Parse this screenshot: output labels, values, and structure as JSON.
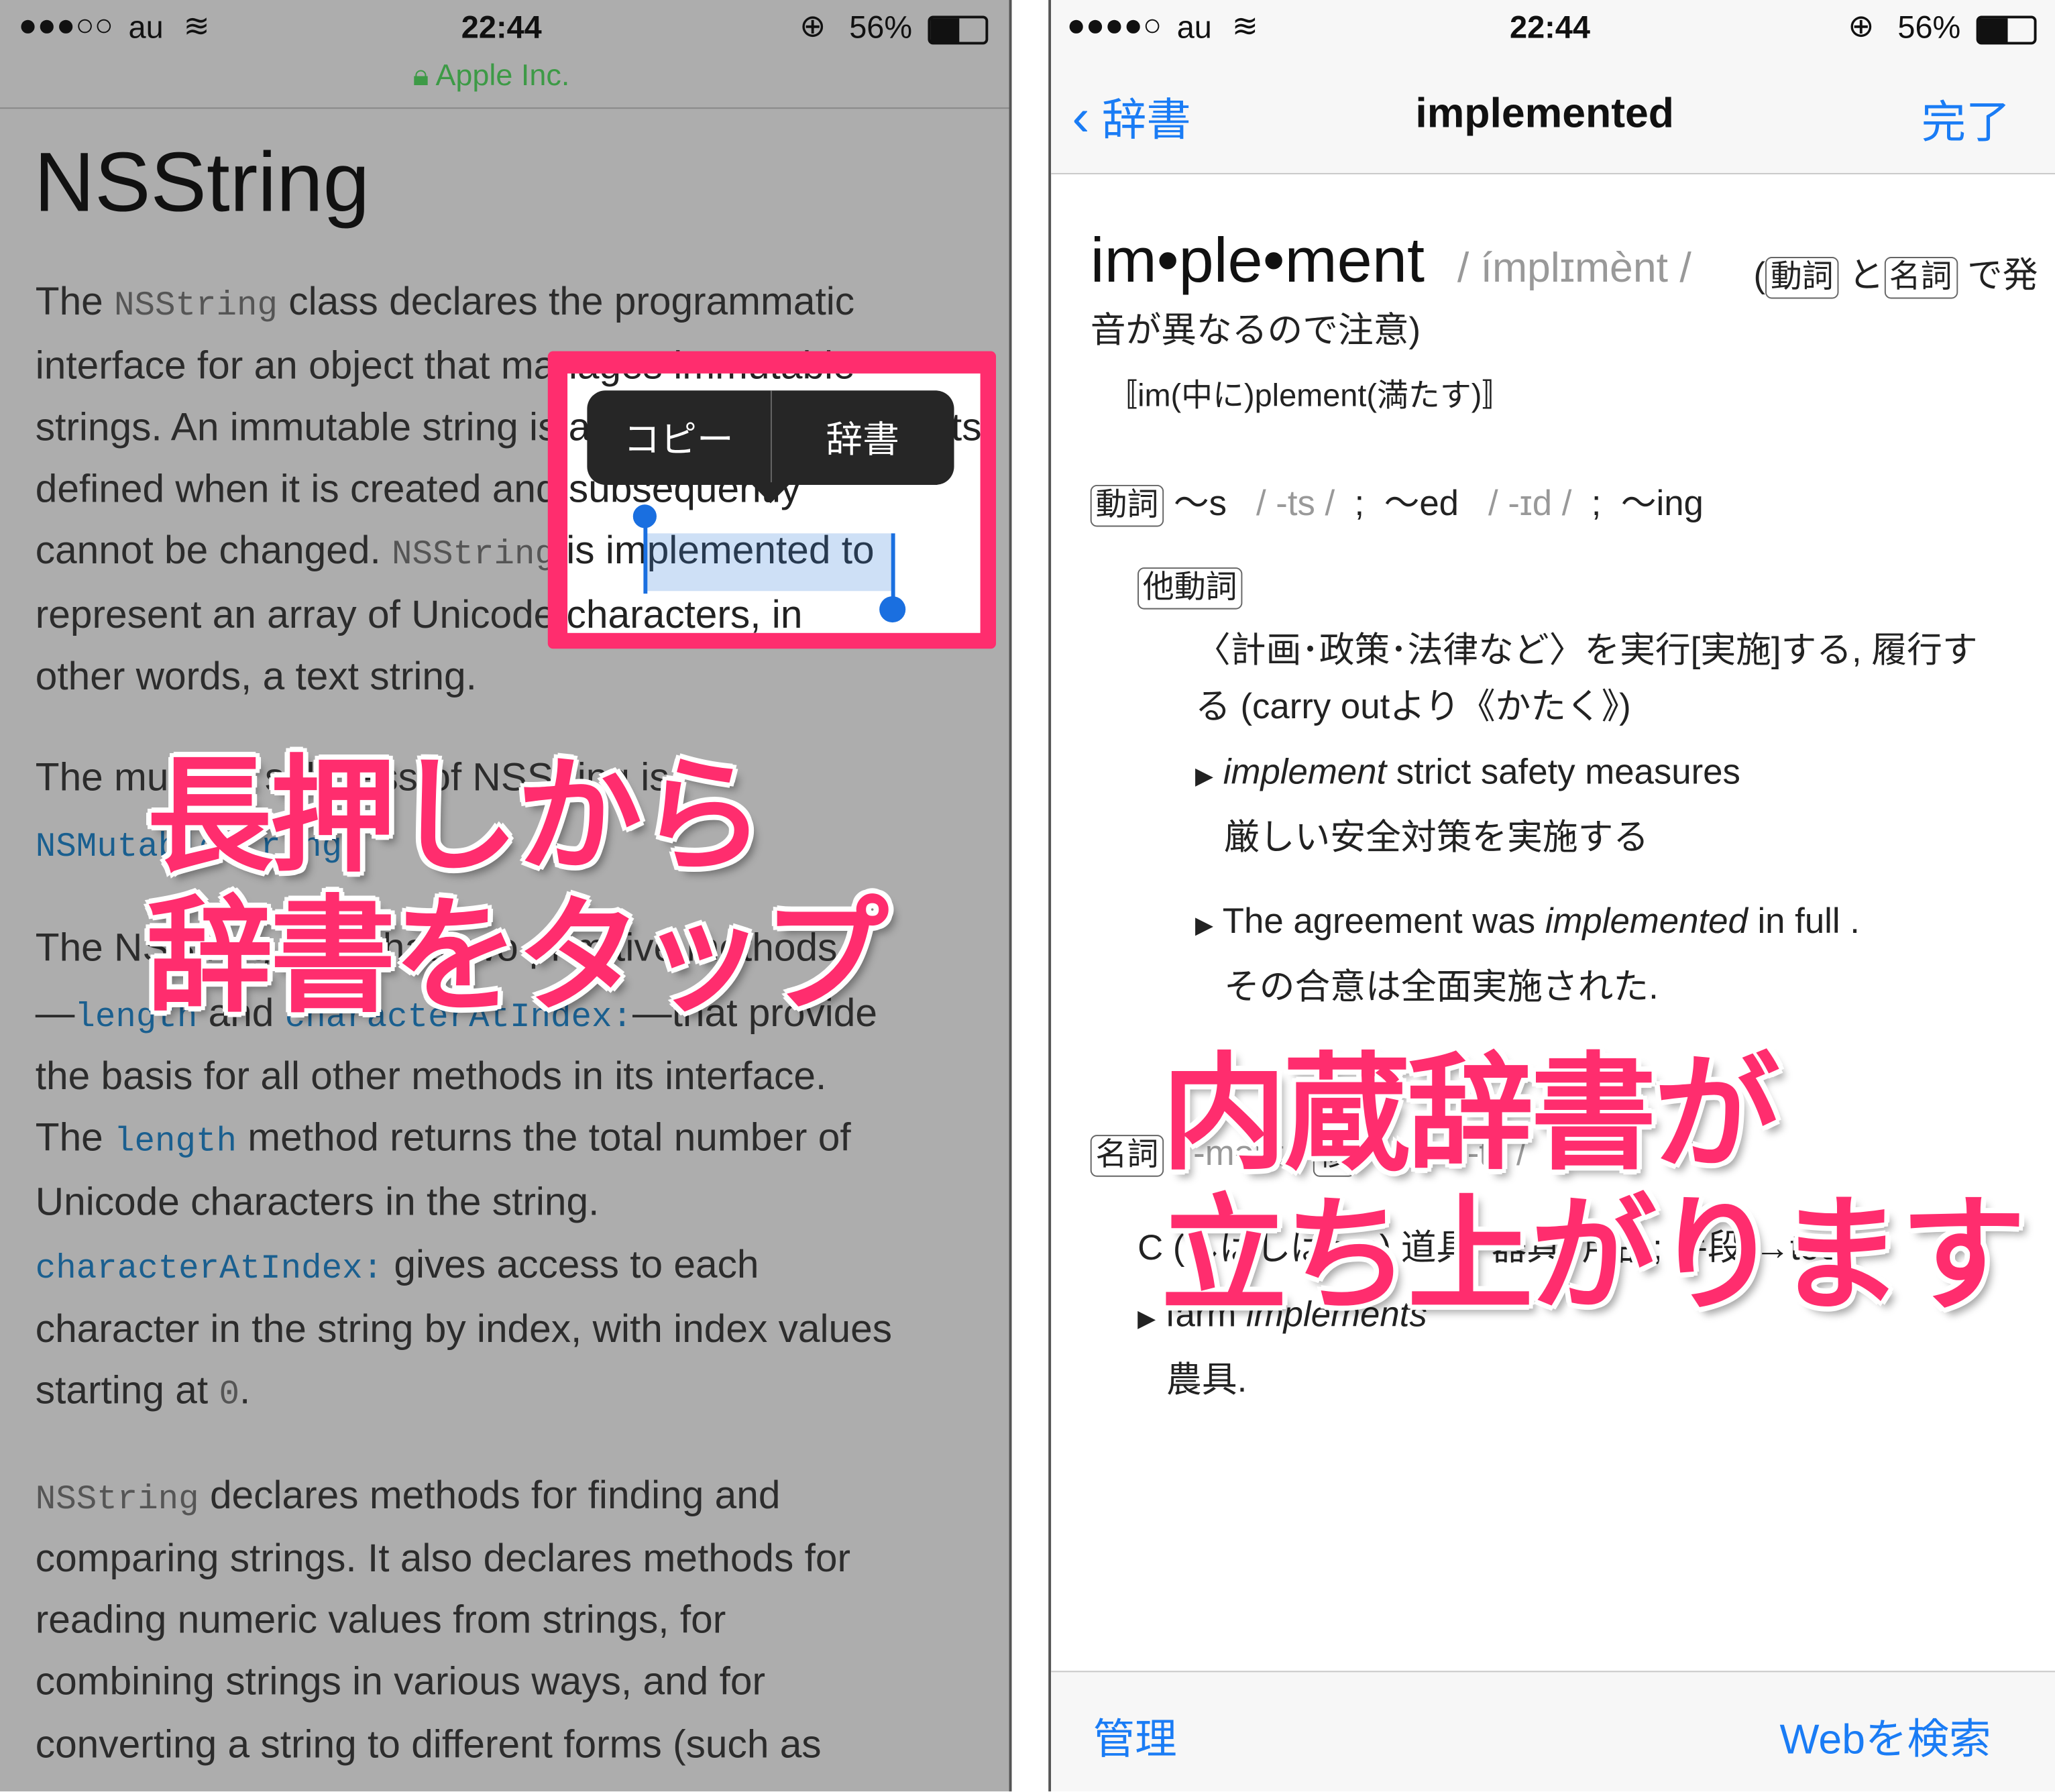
{
  "left": {
    "status": {
      "signal": "●●●○○",
      "carrier": "au",
      "time": "22:44",
      "battery": "56%"
    },
    "site": "Apple Inc.",
    "title": "NSString",
    "lines": [
      [
        {
          "t": "The "
        },
        {
          "t": "NSString",
          "c": "code"
        },
        {
          "t": " class declares the programmatic"
        }
      ],
      [
        {
          "t": "interface for an object that manages immutable"
        }
      ],
      [
        {
          "t": "strings. An immutable string is a string whose contents"
        }
      ],
      [
        {
          "t": "defined when it is created and subsequently"
        }
      ],
      [
        {
          "t": "cannot be changed. "
        },
        {
          "t": "NSString",
          "c": "code"
        },
        {
          "t": " is implemented to"
        }
      ],
      [
        {
          "t": "represent an array of Unicode characters, in"
        }
      ],
      [
        {
          "t": "other words, a text string."
        }
      ],
      [
        {
          "t": "The mutable subclass of NSString is"
        }
      ],
      [
        {
          "t": "NSMutableString",
          "c": "code link"
        }
      ],
      [
        {
          "t": "The NSString class has two primitive methods"
        }
      ],
      [
        {
          "t": "—"
        },
        {
          "t": "length",
          "c": "code link"
        },
        {
          "t": " and "
        },
        {
          "t": "characterAtIndex:",
          "c": "code link"
        },
        {
          "t": "—that provide"
        }
      ],
      [
        {
          "t": "the basis for all other methods in its interface."
        }
      ],
      [
        {
          "t": "The "
        },
        {
          "t": "length",
          "c": "code link"
        },
        {
          "t": " method returns the total number of"
        }
      ],
      [
        {
          "t": "Unicode characters in the string."
        }
      ],
      [
        {
          "t": "characterAtIndex:",
          "c": "code link"
        },
        {
          "t": " gives access to each"
        }
      ],
      [
        {
          "t": "character in the string by index, with index values"
        }
      ],
      [
        {
          "t": "starting at "
        },
        {
          "t": "0",
          "c": "code"
        },
        {
          "t": "."
        }
      ],
      [
        {
          "t": "NSString",
          "c": "code"
        },
        {
          "t": " declares methods for finding and"
        }
      ],
      [
        {
          "t": "comparing strings. It also declares methods for"
        }
      ],
      [
        {
          "t": "reading numeric values from strings, for"
        }
      ],
      [
        {
          "t": "combining strings in various ways, and for"
        }
      ],
      [
        {
          "t": "converting a string to different forms (such as"
        }
      ]
    ],
    "selected_word": "implemented",
    "menu": {
      "copy": "コピー",
      "define": "辞書"
    },
    "caption": [
      "長押しから",
      "辞書をタップ"
    ]
  },
  "right": {
    "status": {
      "signal": "●●●●○",
      "carrier": "au",
      "time": "22:44",
      "battery": "56%"
    },
    "nav": {
      "back": "辞書",
      "title": "implemented",
      "done": "完了"
    },
    "headword": "im•ple•ment",
    "pron": "/ ímplɪmènt /",
    "note_open": "(",
    "tag_verb": "動詞",
    "note_to": "と",
    "tag_noun": "名詞",
    "note_rest1": "で発",
    "note_rest2": "音が異なるので注意)",
    "etym": "〚im(中に)plement(満たす)〛",
    "forms": {
      "s": "〜s",
      "s_pron": "/ -ts /",
      "sep": ";",
      "ed": "〜ed",
      "ed_pron": "/ -ɪd /",
      "ing": "〜ing"
    },
    "tag_transitive": "他動詞",
    "def1a": "〈計画･政策･法律など〉を実行[実施]する, 履行す",
    "def1b": "る (carry outより《かたく》)",
    "ex1_en_i": "implement",
    "ex1_en": " strict safety measures",
    "ex1_ja": "厳しい安全対策を実施する",
    "ex2_en_a": "The agreement was ",
    "ex2_en_i": "implemented",
    "ex2_en_b": " in full .",
    "ex2_ja": "その合意は全面実施された.",
    "noun": {
      "tag": "名詞",
      "pron": "/ -mənt /",
      "plural_tag": "複",
      "s": "〜s",
      "s_pron": "/ -ts /"
    },
    "noun_def": "C (しばしば〜s) 道具, 器具, 用品; 手段(→tool)",
    "ex3_en": "farm ",
    "ex3_en_i": "implements",
    "ex3_ja": "農具.",
    "toolbar": {
      "manage": "管理",
      "search_web": "Webを検索"
    },
    "caption": [
      "内蔵辞書が",
      "立ち上がります"
    ]
  },
  "colors": {
    "accent_pink": "#ff2d6e",
    "ios_blue": "#1a7cf5",
    "site_green": "#3d9a46"
  }
}
